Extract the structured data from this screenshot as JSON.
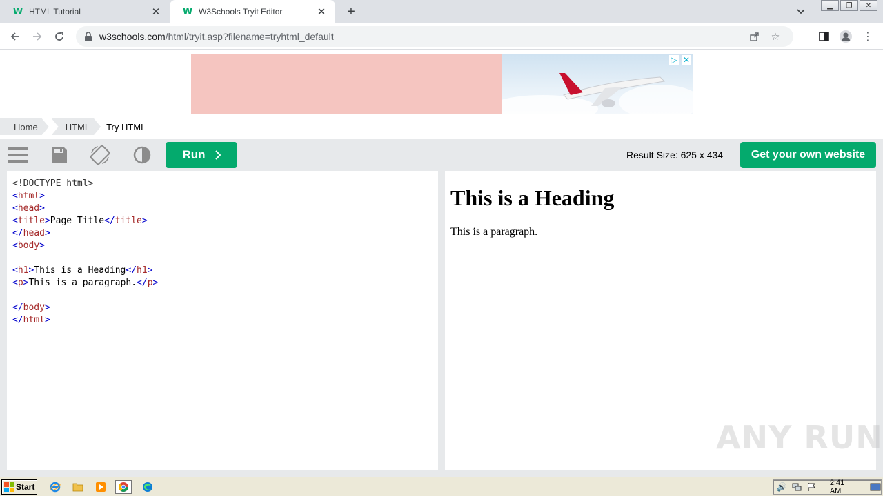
{
  "browser": {
    "tabs": [
      {
        "title": "HTML Tutorial",
        "active": false
      },
      {
        "title": "W3Schools Tryit Editor",
        "active": true
      }
    ],
    "url_host": "w3schools.com",
    "url_path": "/html/tryit.asp?filename=tryhtml_default"
  },
  "breadcrumb": [
    "Home",
    "HTML",
    "Try HTML"
  ],
  "editor_toolbar": {
    "run_label": "Run",
    "result_size": "Result Size: 625 x 434",
    "own_website_label": "Get your own website"
  },
  "code_lines": [
    "<!DOCTYPE html>",
    "<html>",
    "<head>",
    "<title>Page Title</title>",
    "</head>",
    "<body>",
    "",
    "<h1>This is a Heading</h1>",
    "<p>This is a paragraph.</p>",
    "",
    "</body>",
    "</html>"
  ],
  "result": {
    "heading": "This is a Heading",
    "paragraph": "This is a paragraph."
  },
  "watermark": "ANY RUN",
  "taskbar": {
    "start_label": "Start",
    "clock": "2:41 AM"
  },
  "colors": {
    "accent_green": "#04aa6d",
    "tag_blue": "#0000cd",
    "tag_name_brown": "#a52a2a"
  }
}
